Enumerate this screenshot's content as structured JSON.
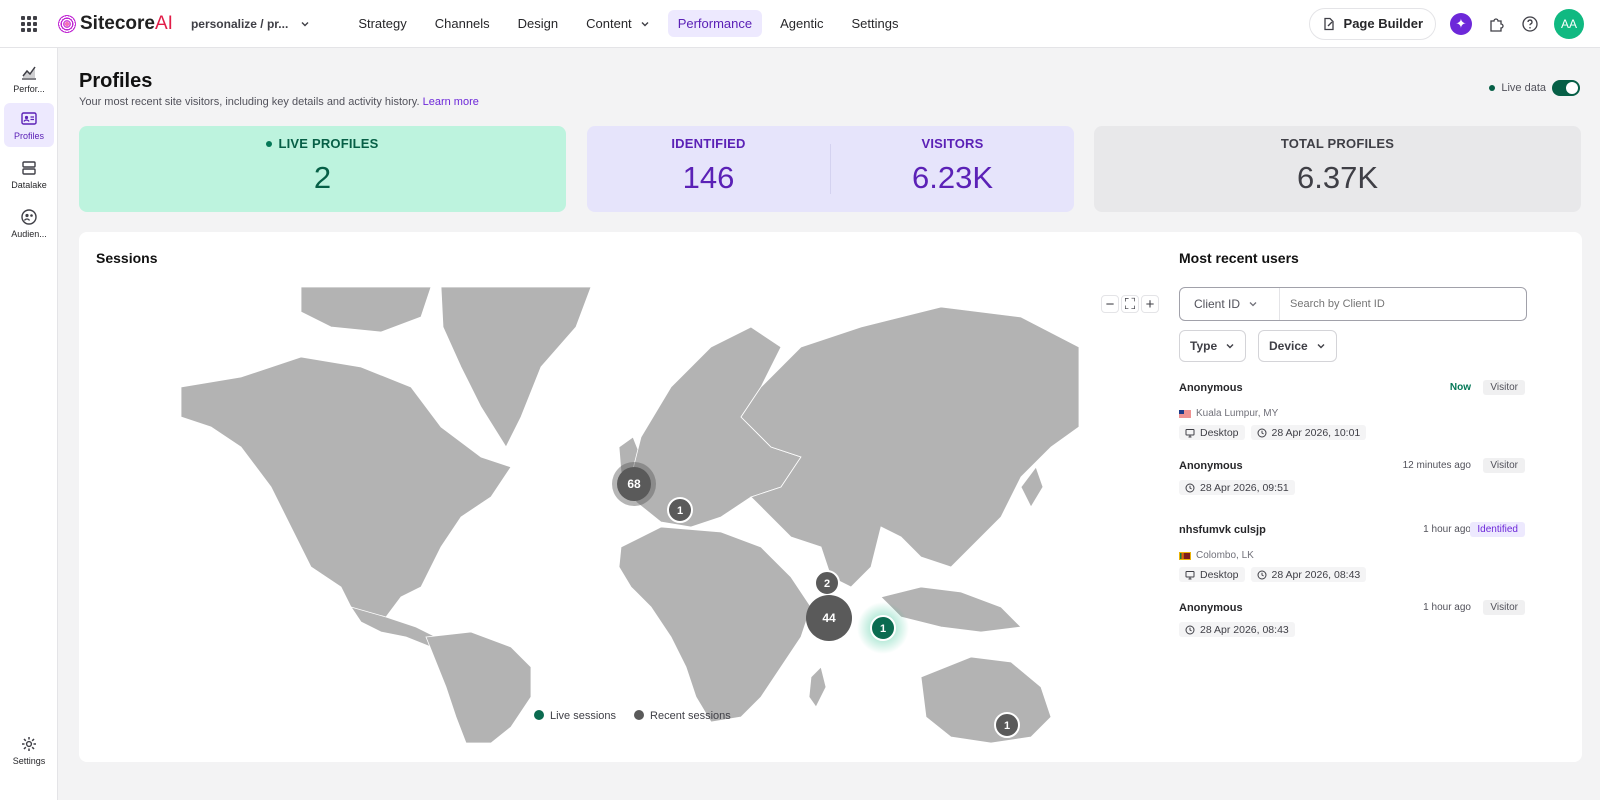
{
  "brand": {
    "name": "Sitecore",
    "suffix": "AI"
  },
  "project": {
    "label": "personalize / pr..."
  },
  "nav": {
    "items": [
      {
        "label": "Strategy"
      },
      {
        "label": "Channels"
      },
      {
        "label": "Design"
      },
      {
        "label": "Content"
      },
      {
        "label": "Performance"
      },
      {
        "label": "Agentic"
      },
      {
        "label": "Settings"
      }
    ],
    "active": "Performance"
  },
  "toolbar": {
    "page_builder": "Page Builder",
    "avatar": "AA"
  },
  "sidebar": {
    "items": [
      {
        "label": "Perfor..."
      },
      {
        "label": "Profiles"
      },
      {
        "label": "Datalake"
      },
      {
        "label": "Audien..."
      }
    ],
    "settings": "Settings"
  },
  "page": {
    "title": "Profiles",
    "subtitle": "Your most recent site visitors, including key details and activity history.",
    "learn_more": "Learn more",
    "live_data": "Live data"
  },
  "stats": {
    "live_profiles": {
      "label": "LIVE PROFILES",
      "value": "2"
    },
    "identified": {
      "label": "IDENTIFIED",
      "value": "146"
    },
    "visitors": {
      "label": "VISITORS",
      "value": "6.23K"
    },
    "total_profiles": {
      "label": "TOTAL PROFILES",
      "value": "6.37K"
    }
  },
  "sessions": {
    "title": "Sessions",
    "clusters": [
      {
        "count": "68",
        "kind": "recent"
      },
      {
        "count": "1",
        "kind": "recent"
      },
      {
        "count": "2",
        "kind": "recent"
      },
      {
        "count": "44",
        "kind": "recent"
      },
      {
        "count": "1",
        "kind": "live"
      },
      {
        "count": "1",
        "kind": "recent"
      }
    ],
    "legend": {
      "live": "Live sessions",
      "recent": "Recent sessions"
    },
    "colors": {
      "live": "#0b6b50",
      "recent": "#5a5a5a",
      "land": "#b3b3b3"
    }
  },
  "recent_users": {
    "title": "Most recent users",
    "search_select": "Client ID",
    "search_placeholder": "Search by Client ID",
    "filters": {
      "type": "Type",
      "device": "Device"
    },
    "users": [
      {
        "name": "Anonymous",
        "time": "Now",
        "badge": "Visitor",
        "location": "Kuala Lumpur, MY",
        "device": "Desktop",
        "date": "28 Apr 2026, 10:01"
      },
      {
        "name": "Anonymous",
        "time": "12 minutes ago",
        "badge": "Visitor",
        "location": "",
        "device": "",
        "date": "28 Apr 2026, 09:51"
      },
      {
        "name": "nhsfumvk culsjp",
        "time": "1 hour ago",
        "badge": "Identified",
        "location": "Colombo, LK",
        "device": "Desktop",
        "date": "28 Apr 2026, 08:43"
      },
      {
        "name": "Anonymous",
        "time": "1 hour ago",
        "badge": "Visitor",
        "location": "",
        "device": "",
        "date": "28 Apr 2026, 08:43"
      }
    ]
  }
}
